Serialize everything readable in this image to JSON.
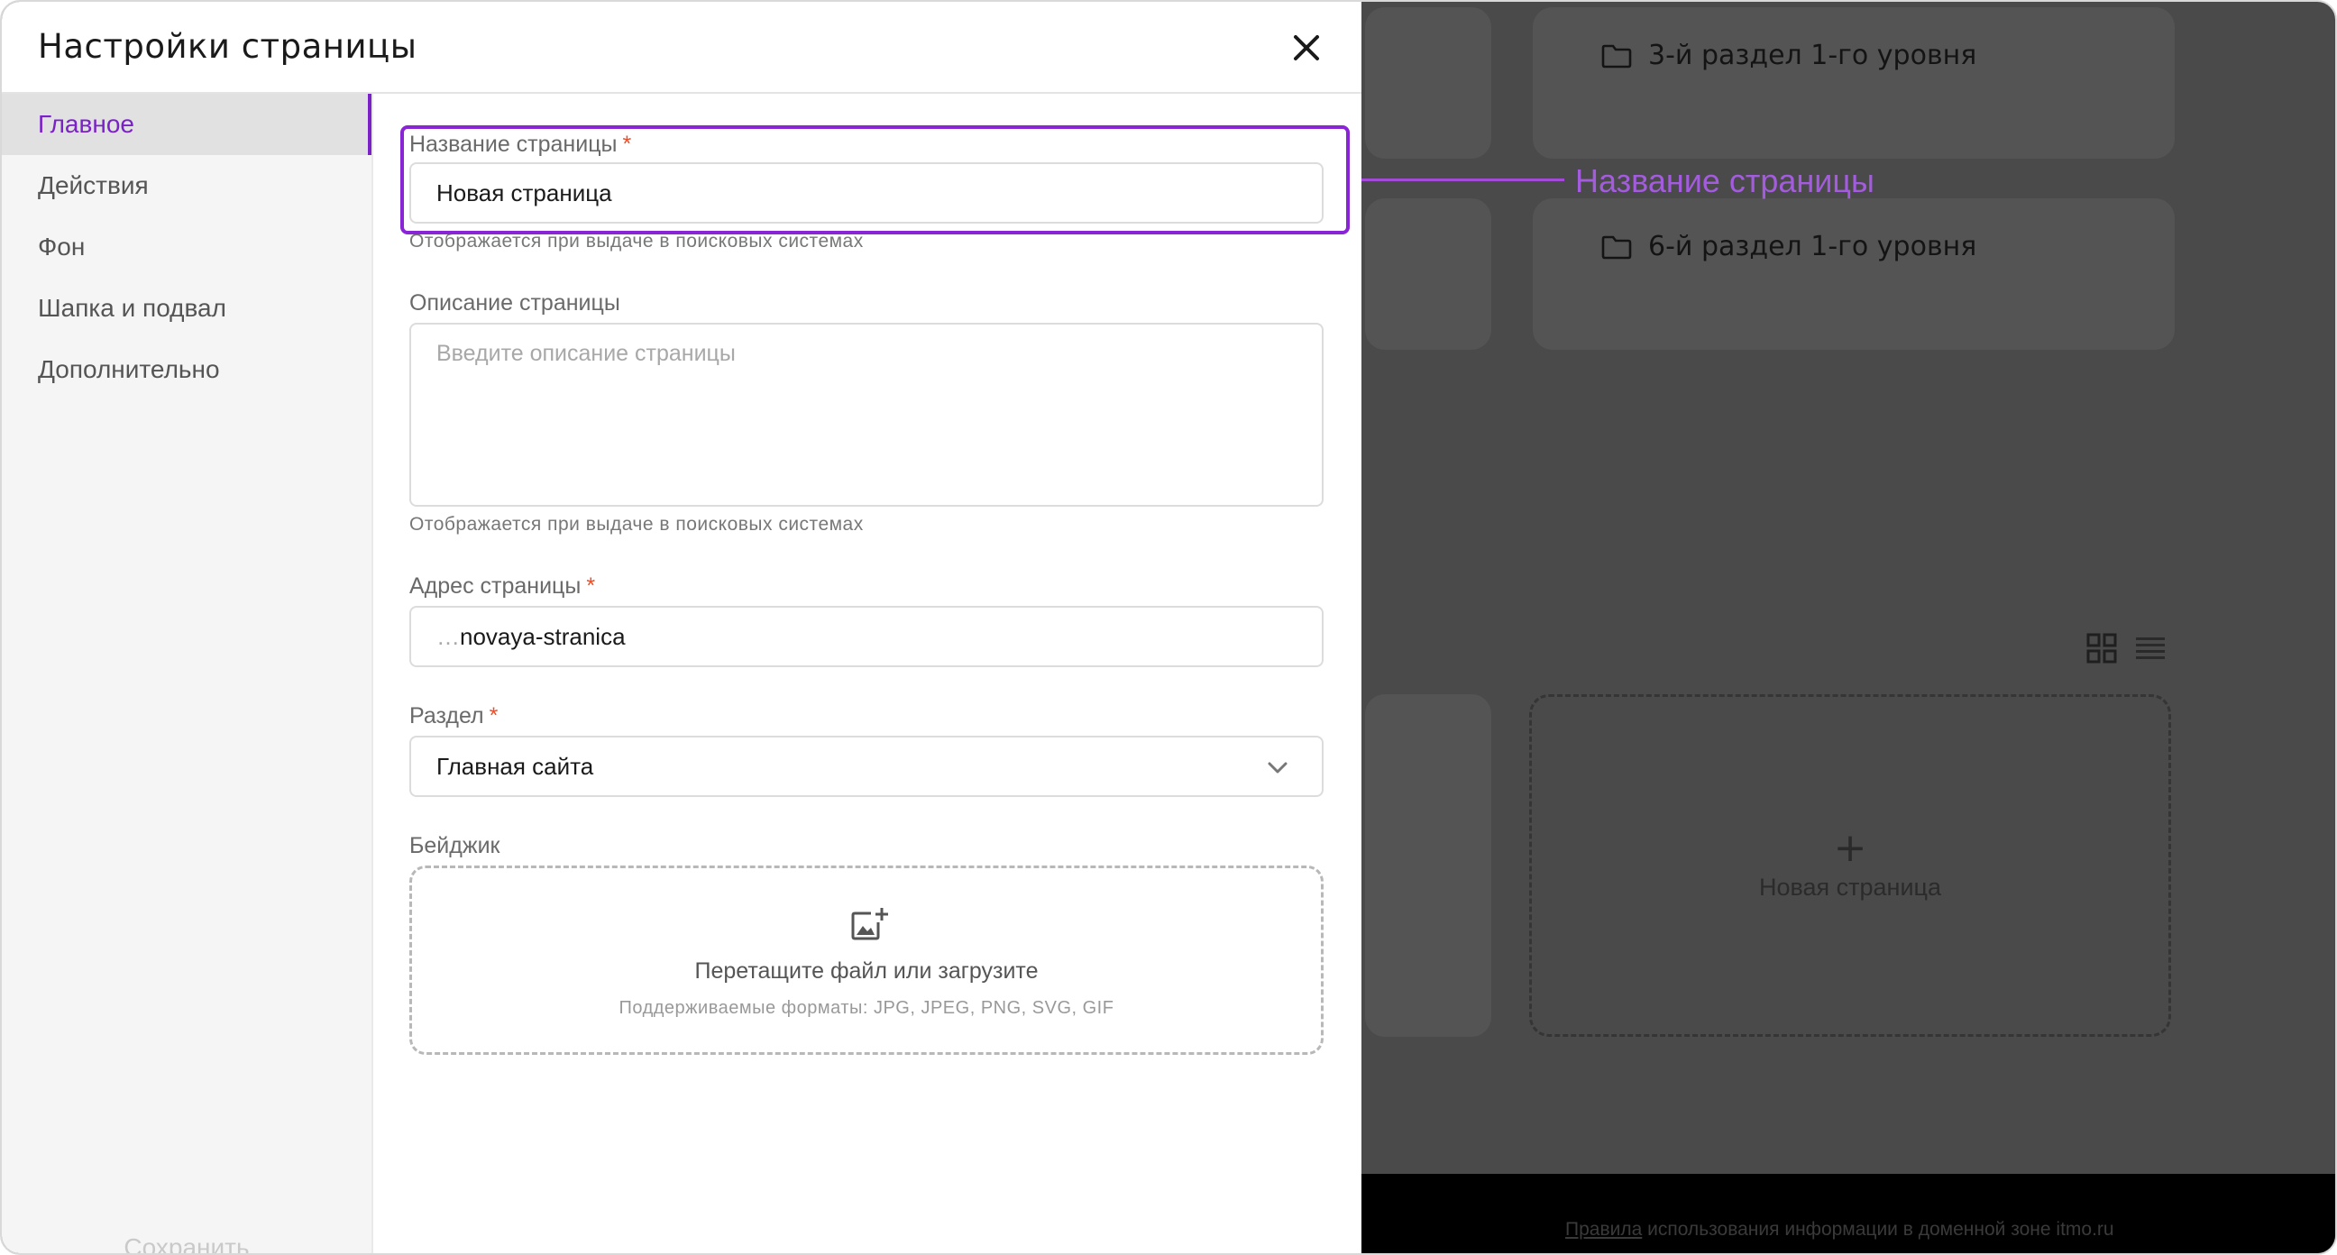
{
  "background": {
    "cards": [
      {
        "title": "3-й раздел 1-го уровня",
        "icon": "folder-icon"
      },
      {
        "title": "6-й раздел 1-го уровня",
        "icon": "folder-icon"
      }
    ],
    "new_page_plus": "+",
    "new_page_label": "Новая страница",
    "footer": {
      "link": "Правила",
      "text": " использования информации в доменной зоне itmo.ru"
    }
  },
  "annotation": {
    "label": "Название страницы",
    "color": "#a45cde"
  },
  "modal": {
    "title": "Настройки страницы",
    "close_icon": "close-icon",
    "nav": [
      {
        "label": "Главное",
        "active": true
      },
      {
        "label": "Действия",
        "active": false
      },
      {
        "label": "Фон",
        "active": false
      },
      {
        "label": "Шапка и подвал",
        "active": false
      },
      {
        "label": "Дополнительно",
        "active": false
      }
    ],
    "save_label": "Сохранить",
    "accent_color": "#7a22c7",
    "fields": {
      "page_name": {
        "label": "Название страницы",
        "required_mark": "*",
        "value": "Новая страница",
        "helper": "Отображается при выдаче в поисковых системах"
      },
      "description": {
        "label": "Описание страницы",
        "placeholder": "Введите описание страницы",
        "helper": "Отображается при выдаче в поисковых системах"
      },
      "address": {
        "label": "Адрес страницы",
        "required_mark": "*",
        "prefix": "…",
        "value": "novaya-stranica"
      },
      "section": {
        "label": "Раздел",
        "required_mark": "*",
        "value": "Главная сайта",
        "icon": "chevron-down-icon"
      },
      "badge": {
        "label": "Бейджик",
        "dropzone_title": "Перетащите файл или загрузите",
        "dropzone_formats": "Поддерживаемые форматы: JPG, JPEG, PNG, SVG, GIF",
        "icon": "add-image-icon"
      }
    }
  }
}
